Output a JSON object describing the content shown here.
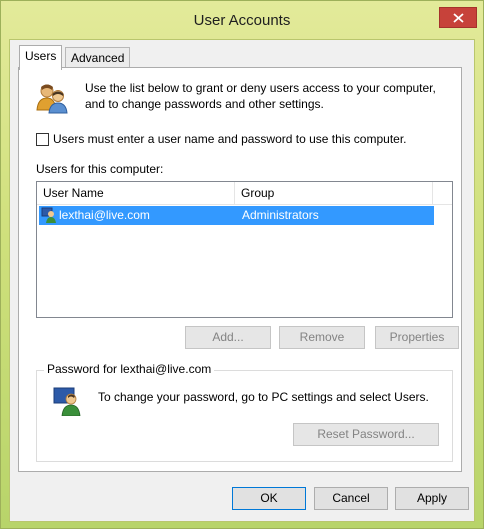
{
  "window": {
    "title": "User Accounts"
  },
  "tabs": [
    {
      "label": "Users",
      "active": true
    },
    {
      "label": "Advanced",
      "active": false
    }
  ],
  "users_tab": {
    "intro_text": "Use the list below to grant or deny users access to your computer, and to change passwords and other settings.",
    "require_password_checkbox": {
      "label": "Users must enter a user name and password to use this computer.",
      "checked": false
    },
    "users_label": "Users for this computer:",
    "list": {
      "columns": [
        "User Name",
        "Group"
      ],
      "rows": [
        {
          "user": "lexthai@live.com",
          "group": "Administrators",
          "selected": true
        }
      ]
    },
    "buttons": {
      "add": "Add...",
      "remove": "Remove",
      "properties": "Properties"
    },
    "password_group": {
      "label": "Password for lexthai@live.com",
      "text": "To change your password, go to PC settings and select Users.",
      "reset_button": "Reset Password..."
    }
  },
  "dialog_buttons": {
    "ok": "OK",
    "cancel": "Cancel",
    "apply": "Apply"
  },
  "colors": {
    "selection": "#3399ff",
    "close_button": "#c7423a",
    "default_button_border": "#0078d7"
  }
}
